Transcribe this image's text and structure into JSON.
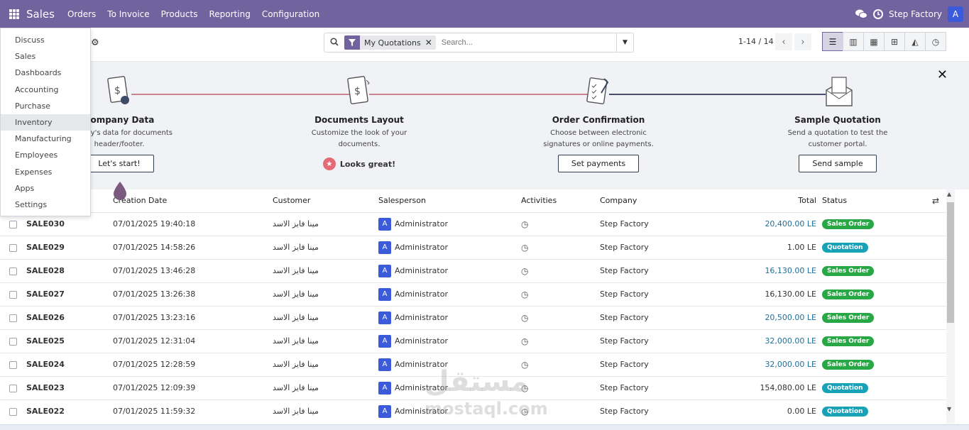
{
  "topbar": {
    "app_name": "Sales",
    "menus": [
      "Orders",
      "To Invoice",
      "Products",
      "Reporting",
      "Configuration"
    ],
    "company": "Step Factory",
    "user_initial": "A",
    "color": "#71639e"
  },
  "apps_menu": {
    "items": [
      "Discuss",
      "Sales",
      "Dashboards",
      "Accounting",
      "Purchase",
      "Inventory",
      "Manufacturing",
      "Employees",
      "Expenses",
      "Apps",
      "Settings"
    ],
    "highlighted": "Inventory"
  },
  "search": {
    "facet": "My Quotations",
    "placeholder": "Search..."
  },
  "pager": {
    "text": "1-14 / 14"
  },
  "onboarding": {
    "steps": [
      {
        "title": "Company Data",
        "desc": "ompany's data for documents header/footer.",
        "button": "Let's start!"
      },
      {
        "title": "Documents Layout",
        "desc": "Customize the look of your documents.",
        "done": "Looks great!"
      },
      {
        "title": "Order Confirmation",
        "desc": "Choose between electronic signatures or online payments.",
        "button": "Set payments"
      },
      {
        "title": "Sample Quotation",
        "desc": "Send a quotation to test the customer portal.",
        "button": "Send sample"
      }
    ]
  },
  "table": {
    "headers": {
      "date": "Creation Date",
      "customer": "Customer",
      "salesperson": "Salesperson",
      "activities": "Activities",
      "company": "Company",
      "total": "Total",
      "status": "Status"
    },
    "rows": [
      {
        "ref": "SALE030",
        "date": "07/01/2025 19:40:18",
        "customer": "مينا فايز الاسد",
        "salesperson": "Administrator",
        "company": "Step Factory",
        "total": "20,400.00 LE",
        "status": "Sales Order"
      },
      {
        "ref": "SALE029",
        "date": "07/01/2025 14:58:26",
        "customer": "مينا فايز الاسد",
        "salesperson": "Administrator",
        "company": "Step Factory",
        "total": "1.00 LE",
        "status": "Quotation"
      },
      {
        "ref": "SALE028",
        "date": "07/01/2025 13:46:28",
        "customer": "مينا فايز الاسد",
        "salesperson": "Administrator",
        "company": "Step Factory",
        "total": "16,130.00 LE",
        "status": "Sales Order"
      },
      {
        "ref": "SALE027",
        "date": "07/01/2025 13:26:38",
        "customer": "مينا فايز الاسد",
        "salesperson": "Administrator",
        "company": "Step Factory",
        "total": "16,130.00 LE",
        "status": "Sales Order"
      },
      {
        "ref": "SALE026",
        "date": "07/01/2025 13:23:16",
        "customer": "مينا فايز الاسد",
        "salesperson": "Administrator",
        "company": "Step Factory",
        "total": "20,500.00 LE",
        "status": "Sales Order"
      },
      {
        "ref": "SALE025",
        "date": "07/01/2025 12:31:04",
        "customer": "مينا فايز الاسد",
        "salesperson": "Administrator",
        "company": "Step Factory",
        "total": "32,000.00 LE",
        "status": "Sales Order"
      },
      {
        "ref": "SALE024",
        "date": "07/01/2025 12:28:59",
        "customer": "مينا فايز الاسد",
        "salesperson": "Administrator",
        "company": "Step Factory",
        "total": "32,000.00 LE",
        "status": "Sales Order"
      },
      {
        "ref": "SALE023",
        "date": "07/01/2025 12:09:39",
        "customer": "مينا فايز الاسد",
        "salesperson": "Administrator",
        "company": "Step Factory",
        "total": "154,080.00 LE",
        "status": "Quotation"
      },
      {
        "ref": "SALE022",
        "date": "07/01/2025 11:59:32",
        "customer": "مينا فايز الاسد",
        "salesperson": "Administrator",
        "company": "Step Factory",
        "total": "0.00 LE",
        "status": "Quotation"
      }
    ],
    "blue_totals": [
      true,
      false,
      true,
      false,
      true,
      true,
      true,
      false,
      false
    ]
  },
  "colors": {
    "sales_order": "#28a745",
    "quotation": "#17a2b8",
    "avatar": "#3b5bdb"
  },
  "watermark": {
    "arabic": "مستقل",
    "latin": "mostaql.com"
  }
}
